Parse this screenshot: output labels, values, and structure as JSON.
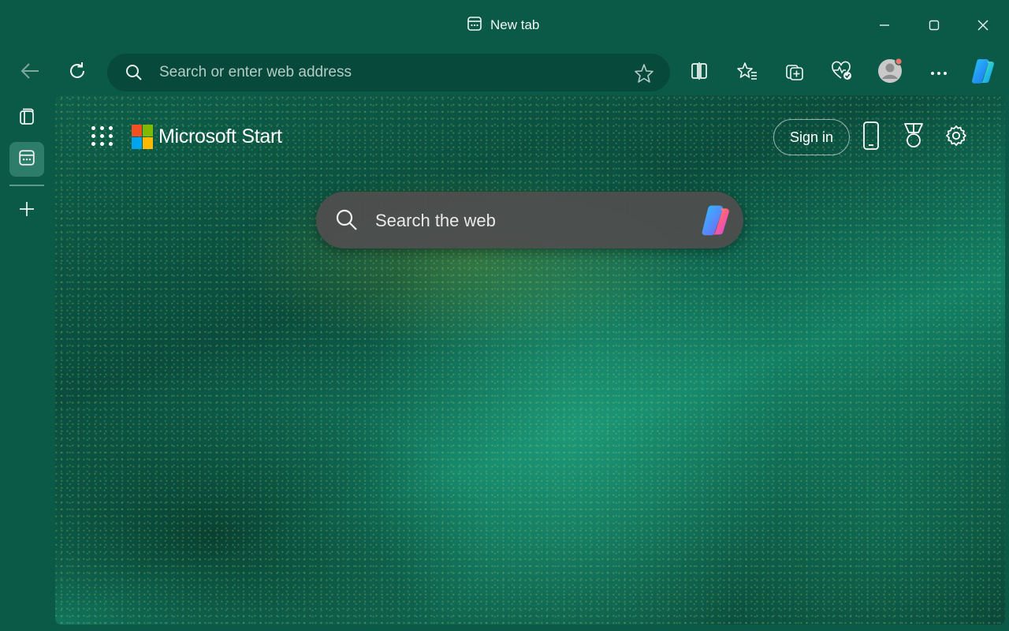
{
  "window": {
    "tab_title": "New tab",
    "controls": [
      "minimize",
      "maximize",
      "close"
    ]
  },
  "toolbar": {
    "address_placeholder": "Search or enter web address",
    "icons": [
      "back-icon",
      "refresh-icon",
      "search-icon",
      "favorite-star-icon",
      "split-screen-icon",
      "favorites-icon",
      "collections-icon",
      "browser-essentials-icon",
      "profile-avatar",
      "more-icon",
      "copilot-icon"
    ]
  },
  "sidebar": {
    "items": [
      "tab-actions",
      "new-tab-page",
      "new-tab"
    ]
  },
  "page": {
    "brand": "Microsoft Start",
    "sign_in_label": "Sign in",
    "search_placeholder": "Search the web",
    "icons": [
      "apps-icon",
      "phone-icon",
      "rewards-icon",
      "settings-icon",
      "copilot-icon"
    ]
  },
  "colors": {
    "chrome": "#0b5a48",
    "address_bar": "#074a3b",
    "search_box": "#4e4e4e",
    "ms_red": "#f25022",
    "ms_green": "#7fba00",
    "ms_blue": "#00a4ef",
    "ms_yellow": "#ffb900"
  }
}
